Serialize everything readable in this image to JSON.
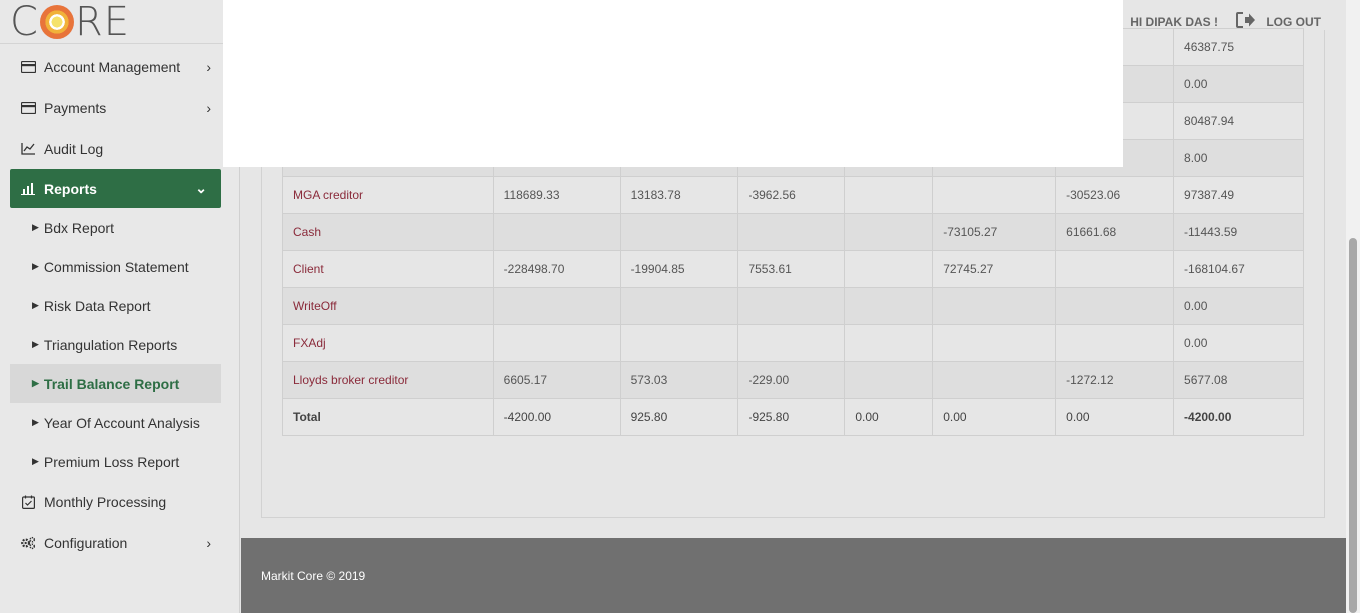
{
  "logo": {
    "text_left": "C",
    "text_right": "RE"
  },
  "header": {
    "greeting": "HI DIPAK DAS !",
    "logout_label": "LOG OUT"
  },
  "sidebar": {
    "items": [
      {
        "label": "Account Management",
        "icon": "credit-card-icon"
      },
      {
        "label": "Payments",
        "icon": "credit-card-icon"
      },
      {
        "label": "Audit Log",
        "icon": "line-chart-icon"
      },
      {
        "label": "Reports",
        "icon": "bar-chart-icon"
      },
      {
        "label": "Monthly Processing",
        "icon": "calendar-check-icon"
      },
      {
        "label": "Configuration",
        "icon": "cogs-icon"
      }
    ],
    "reports_sub": [
      "Bdx Report",
      "Commission Statement",
      "Risk Data Report",
      "Triangulation Reports",
      "Trail Balance Report",
      "Year Of Account Analysis",
      "Premium Loss Report"
    ]
  },
  "table": {
    "partial_top": [
      [
        "",
        "",
        "",
        "",
        "",
        "",
        "",
        "46387.75"
      ],
      [
        "",
        "",
        "",
        "",
        "",
        "",
        "",
        "0.00"
      ],
      [
        "",
        "",
        "",
        "",
        "",
        "",
        "",
        "80487.94"
      ],
      [
        "",
        "",
        "",
        "",
        "",
        "",
        "",
        "8.00"
      ]
    ],
    "rows": [
      [
        "MGA creditor",
        "118689.33",
        "13183.78",
        "-3962.56",
        "",
        "",
        "-30523.06",
        "97387.49"
      ],
      [
        "Cash",
        "",
        "",
        "",
        "",
        "-73105.27",
        "61661.68",
        "-11443.59"
      ],
      [
        "Client",
        "-228498.70",
        "-19904.85",
        "7553.61",
        "",
        "72745.27",
        "",
        "-168104.67"
      ],
      [
        "WriteOff",
        "",
        "",
        "",
        "",
        "",
        "",
        "0.00"
      ],
      [
        "FXAdj",
        "",
        "",
        "",
        "",
        "",
        "",
        "0.00"
      ],
      [
        "Lloyds broker creditor",
        "6605.17",
        "573.03",
        "-229.00",
        "",
        "",
        "-1272.12",
        "5677.08"
      ]
    ],
    "total": [
      "Total",
      "-4200.00",
      "925.80",
      "-925.80",
      "0.00",
      "0.00",
      "0.00",
      "-4200.00"
    ]
  },
  "footer": {
    "text": "Markit Core © 2019"
  }
}
